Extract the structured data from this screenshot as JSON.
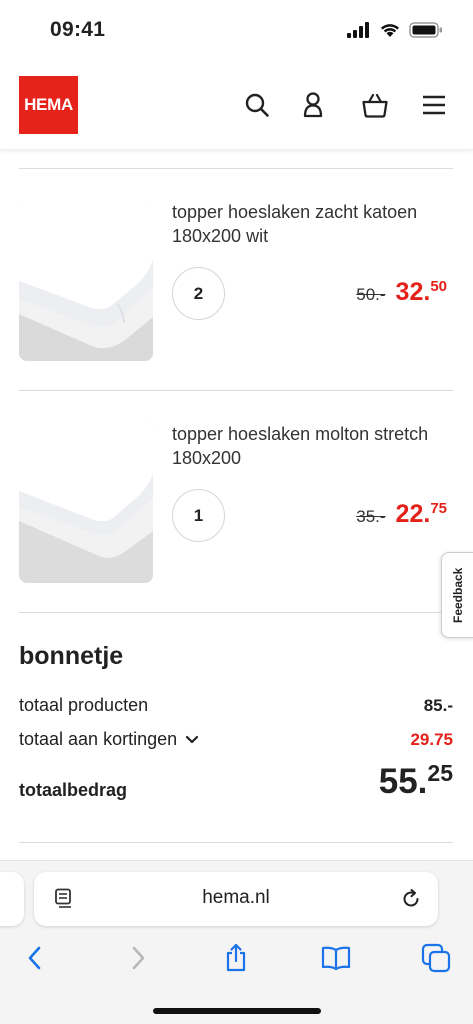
{
  "status_bar": {
    "time": "09:41"
  },
  "header": {
    "logo_text": "HEMA",
    "icons": [
      "search-icon",
      "account-icon",
      "basket-icon",
      "menu-icon"
    ],
    "brand_color": "#e5231b"
  },
  "cart": {
    "items": [
      {
        "title": "topper hoeslaken zacht katoen 180x200 wit",
        "quantity": "2",
        "old_price": "50.-",
        "new_price_main": "32.",
        "new_price_cents": "50"
      },
      {
        "title": "topper hoeslaken molton stretch 180x200",
        "quantity": "1",
        "old_price": "35.-",
        "new_price_main": "22.",
        "new_price_cents": "75"
      }
    ]
  },
  "feedback_tab": "Feedback",
  "receipt": {
    "title": "bonnetje",
    "products_label": "totaal producten",
    "products_value": "85.-",
    "discounts_label": "totaal aan kortingen",
    "discounts_value": "29.75",
    "total_label": "totaalbedrag",
    "total_main": "55.",
    "total_cents": "25"
  },
  "browser": {
    "url": "hema.nl",
    "accent_color": "#1a73e8"
  },
  "colors": {
    "price_red": "#e32119"
  }
}
